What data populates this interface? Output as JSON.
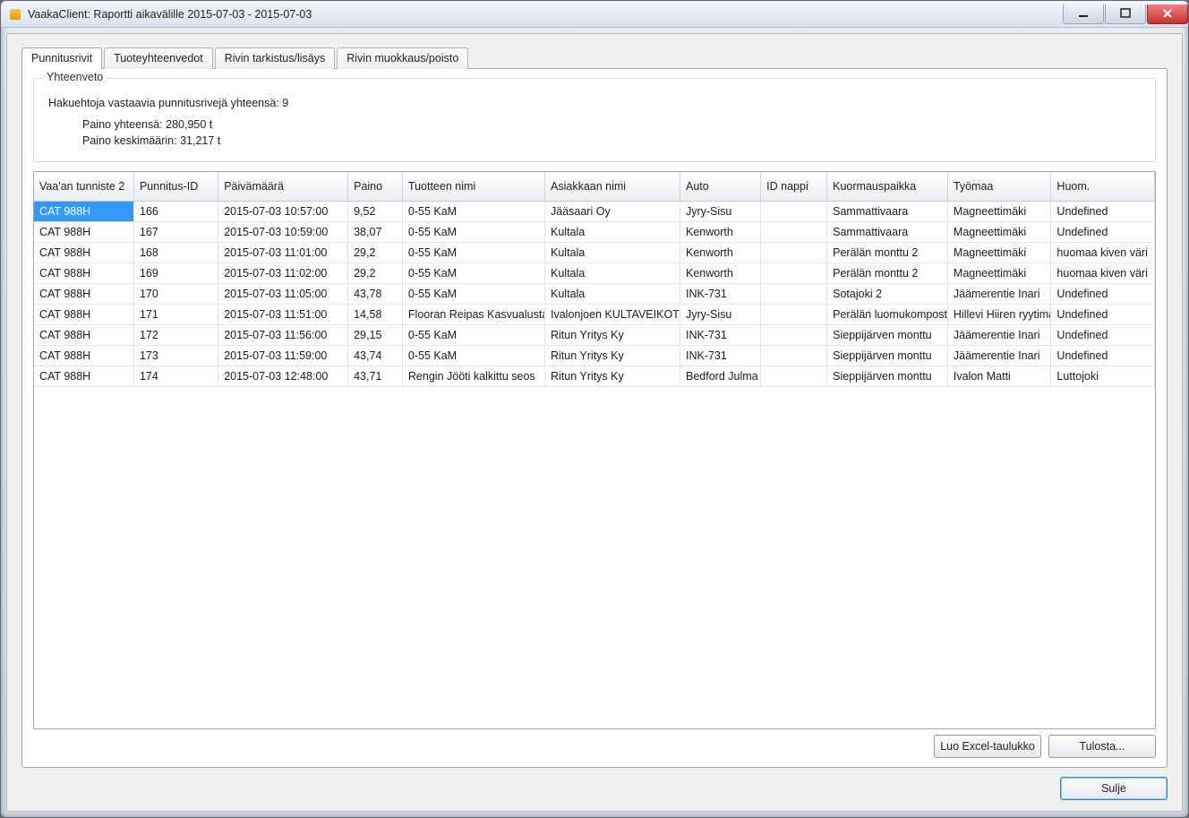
{
  "window": {
    "title": "VaakaClient: Raportti aikavälille 2015-07-03 - 2015-07-03"
  },
  "tabs": [
    {
      "label": "Punnitusrivit"
    },
    {
      "label": "Tuoteyhteenvedot"
    },
    {
      "label": "Rivin tarkistus/lisäys"
    },
    {
      "label": "Rivin muokkaus/poisto"
    }
  ],
  "summary": {
    "legend": "Yhteenveto",
    "count_label": "Hakuehtoja vastaavia punnitusrivejä yhteensä:",
    "count_value": "9",
    "weight_total_label": "Paino yhteensä:",
    "weight_total_value": "280,950 t",
    "weight_avg_label": "Paino keskimäärin:",
    "weight_avg_value": "31,217 t"
  },
  "columns": [
    "Vaa'an tunniste 2",
    "Punnitus-ID",
    "Päivämäärä",
    "Paino",
    "Tuotteen nimi",
    "Asiakkaan nimi",
    "Auto",
    "ID nappi",
    "Kuormauspaikka",
    "Työmaa",
    "Huom."
  ],
  "rows": [
    {
      "c": [
        "CAT 988H",
        "166",
        "2015-07-03 10:57:00",
        "9,52",
        "0-55 KaM",
        "Jääsaari Oy",
        "Jyry-Sisu",
        "",
        "Sammattivaara",
        "Magneettimäki",
        "Undefined"
      ],
      "selected": true
    },
    {
      "c": [
        "CAT 988H",
        "167",
        "2015-07-03 10:59:00",
        "38,07",
        "0-55 KaM",
        "Kultala",
        "Kenworth",
        "",
        "Sammattivaara",
        "Magneettimäki",
        "Undefined"
      ]
    },
    {
      "c": [
        "CAT 988H",
        "168",
        "2015-07-03 11:01:00",
        "29,2",
        "0-55 KaM",
        "Kultala",
        "Kenworth",
        "",
        "Perälän monttu 2",
        "Magneettimäki",
        "huomaa kiven väri"
      ]
    },
    {
      "c": [
        "CAT 988H",
        "169",
        "2015-07-03 11:02:00",
        "29,2",
        "0-55 KaM",
        "Kultala",
        "Kenworth",
        "",
        "Perälän monttu 2",
        "Magneettimäki",
        "huomaa kiven väri"
      ]
    },
    {
      "c": [
        "CAT 988H",
        "170",
        "2015-07-03 11:05:00",
        "43,78",
        "0-55 KaM",
        "Kultala",
        "INK-731",
        "",
        "Sotajoki 2",
        "Jäämerentie Inari",
        "Undefined"
      ]
    },
    {
      "c": [
        "CAT 988H",
        "171",
        "2015-07-03 11:51:00",
        "14,58",
        "Flooran Reipas Kasvualusta",
        "Ivalonjoen KULTAVEIKOT",
        "Jyry-Sisu",
        "",
        "Perälän luomukomposti",
        "Hillevi Hiiren ryytimaa",
        "Undefined"
      ]
    },
    {
      "c": [
        "CAT 988H",
        "172",
        "2015-07-03 11:56:00",
        "29,15",
        "0-55 KaM",
        "Ritun Yritys Ky",
        "INK-731",
        "",
        "Sieppijärven monttu",
        "Jäämerentie Inari",
        "Undefined"
      ]
    },
    {
      "c": [
        "CAT 988H",
        "173",
        "2015-07-03 11:59:00",
        "43,74",
        "0-55 KaM",
        "Ritun Yritys Ky",
        "INK-731",
        "",
        "Sieppijärven monttu",
        "Jäämerentie Inari",
        "Undefined"
      ]
    },
    {
      "c": [
        "CAT 988H",
        "174",
        "2015-07-03 12:48:00",
        "43,71",
        "Rengin Jööti kalkittu seos",
        "Ritun Yritys Ky",
        "Bedford Julma",
        "",
        "Sieppijärven monttu",
        "Ivalon Matti",
        "Luttojoki"
      ]
    }
  ],
  "buttons": {
    "excel": "Luo Excel-taulukko",
    "print": "Tulosta...",
    "close": "Sulje"
  }
}
